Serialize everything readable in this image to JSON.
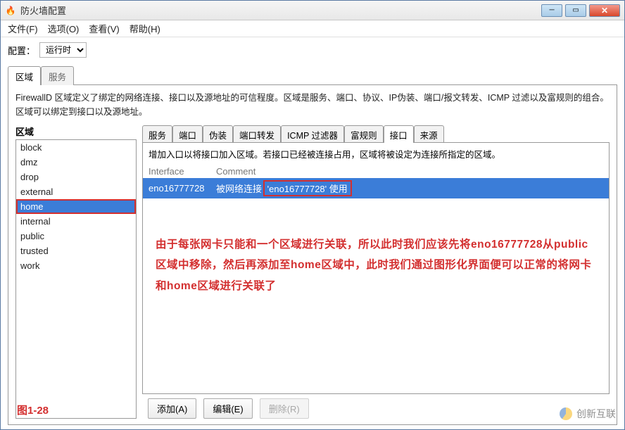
{
  "window": {
    "title": "防火墙配置"
  },
  "menu": {
    "file": "文件(F)",
    "options": "选项(O)",
    "view": "查看(V)",
    "help": "帮助(H)"
  },
  "config": {
    "label": "配置：",
    "selected": "运行时"
  },
  "outer_tabs": {
    "zone": "区域",
    "service": "服务"
  },
  "description": "FirewallD 区域定义了绑定的网络连接、接口以及源地址的可信程度。区域是服务、端口、协议、IP伪装、端口/报文转发、ICMP 过滤以及富规则的组合。区域可以绑定到接口以及源地址。",
  "zone_header": "区域",
  "zones": [
    "block",
    "dmz",
    "drop",
    "external",
    "home",
    "internal",
    "public",
    "trusted",
    "work"
  ],
  "selected_zone_index": 4,
  "inner_tabs": {
    "services": "服务",
    "ports": "端口",
    "masq": "伪装",
    "portfwd": "端口转发",
    "icmp": "ICMP 过滤器",
    "rich": "富规则",
    "iface": "接口",
    "source": "来源"
  },
  "inner_desc": "增加入口以将接口加入区域。若接口已经被连接占用，区域将被设定为连接所指定的区域。",
  "columns": {
    "iface": "Interface",
    "comment": "Comment"
  },
  "iface_row": {
    "name": "eno16777728",
    "conn": "被网络连接",
    "used": "'eno16777728' 使用"
  },
  "buttons": {
    "add": "添加(A)",
    "edit": "编辑(E)",
    "remove": "删除(R)"
  },
  "annotation": "由于每张网卡只能和一个区域进行关联，所以此时我们应该先将eno16777728从public区域中移除，然后再添加至home区域中，此时我们通过图形化界面便可以正常的将网卡和home区域进行关联了",
  "figure": "图1-28",
  "watermark": "创新互联",
  "icons": {
    "app": "🔥"
  }
}
